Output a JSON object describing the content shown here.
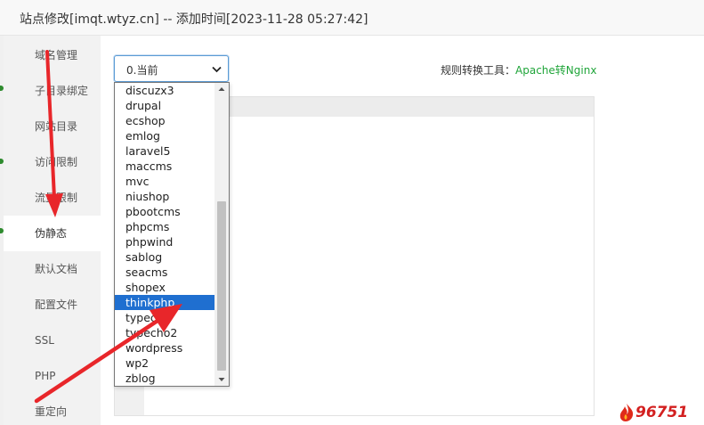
{
  "window": {
    "title": "站点修改[imqt.wtyz.cn] -- 添加时间[2023-11-28 05:27:42]"
  },
  "sidebar": {
    "items": [
      {
        "label": "域名管理"
      },
      {
        "label": "子目录绑定"
      },
      {
        "label": "网站目录"
      },
      {
        "label": "访问限制"
      },
      {
        "label": "流量限制"
      },
      {
        "label": "伪静态",
        "active": true
      },
      {
        "label": "默认文档"
      },
      {
        "label": "配置文件"
      },
      {
        "label": "SSL"
      },
      {
        "label": "PHP"
      },
      {
        "label": "重定向"
      }
    ]
  },
  "rewrite": {
    "select_value": "0.当前",
    "tool_label": "规则转换工具：",
    "tool_link": "Apache转Nginx"
  },
  "dropdown": {
    "options": [
      "discuzx3",
      "drupal",
      "ecshop",
      "emlog",
      "laravel5",
      "maccms",
      "mvc",
      "niushop",
      "pbootcms",
      "phpcms",
      "phpwind",
      "sablog",
      "seacms",
      "shopex",
      "thinkphp",
      "typecho",
      "typecho2",
      "wordpress",
      "wp2",
      "zblog"
    ],
    "selected": "thinkphp"
  },
  "colors": {
    "accent_green": "#20a53a",
    "selection_blue": "#1f6fd0",
    "annotation_red": "#e8262a"
  },
  "icons": {
    "select": "chevron-down-icon",
    "scroll_up": "triangle-up-icon",
    "scroll_down": "triangle-down-icon"
  },
  "watermark": {
    "text": "96751"
  }
}
